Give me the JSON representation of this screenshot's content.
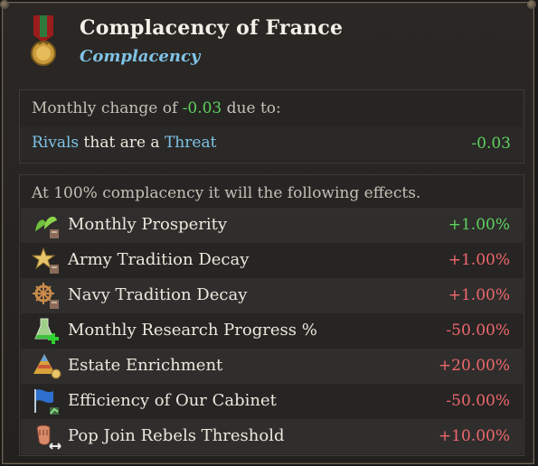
{
  "header": {
    "title": "Complacency of France",
    "subtitle": "Complacency"
  },
  "monthly": {
    "prefix": "Monthly change of ",
    "value": "-0.03",
    "suffix": " due to:",
    "reason": {
      "part1": "Rivals",
      "part2": " that are a ",
      "part3": "Threat",
      "value": "-0.03"
    }
  },
  "effects": {
    "intro": "At 100% complacency it will the following effects.",
    "items": [
      {
        "label": "Monthly Prosperity",
        "value": "+1.00%",
        "color": "#5fd05f",
        "icon": "prosperity-leaves-icon"
      },
      {
        "label": "Army Tradition Decay",
        "value": "+1.00%",
        "color": "#f0676e",
        "icon": "army-tradition-star-icon"
      },
      {
        "label": "Navy Tradition Decay",
        "value": "+1.00%",
        "color": "#f0676e",
        "icon": "ship-wheel-icon"
      },
      {
        "label": "Monthly Research Progress %",
        "value": "-50.00%",
        "color": "#f0676e",
        "icon": "research-flask-icon"
      },
      {
        "label": "Estate Enrichment",
        "value": "+20.00%",
        "color": "#f0676e",
        "icon": "estate-pyramid-icon"
      },
      {
        "label": "Efficiency of Our Cabinet",
        "value": "-50.00%",
        "color": "#f0676e",
        "icon": "cabinet-flag-icon"
      },
      {
        "label": "Pop Join Rebels Threshold",
        "value": "+10.00%",
        "color": "#f0676e",
        "icon": "rebel-fist-icon"
      }
    ]
  }
}
